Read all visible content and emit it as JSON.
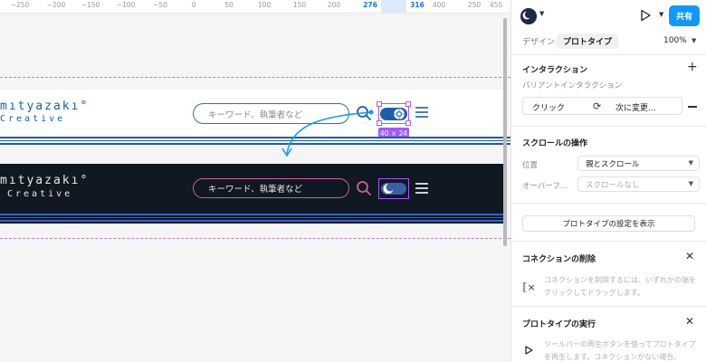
{
  "ruler": {
    "ticks": [
      "−250",
      "−200",
      "−150",
      "−100",
      "−50",
      "0",
      "50",
      "100",
      "150",
      "200",
      "250",
      "276",
      "316",
      "400",
      "450"
    ]
  },
  "canvas": {
    "logo_line1": "mıtyazakı°",
    "logo_line2": "Creative",
    "search_placeholder_light": "キーワード、執筆者など",
    "search_placeholder_dark": "キーワード、執筆者など",
    "size_badge": "40 × 24"
  },
  "toolbar": {
    "share_label": "共有",
    "tabs": [
      "デザイン",
      "プロトタイプ"
    ],
    "active_tab": "プロトタイプ",
    "zoom": "100%"
  },
  "interaction": {
    "title": "インタラクション",
    "subtitle": "バリアントインタラクション",
    "trigger": "クリック",
    "action": "次に変更..."
  },
  "scroll": {
    "title": "スクロールの操作",
    "position_label": "位置",
    "position_value": "親とスクロール",
    "overflow_label": "オーバーフ...",
    "overflow_value": "スクロールなし"
  },
  "settings_button": "プロトタイプの設定を表示",
  "connection": {
    "title": "コネクションの削除",
    "help": "コネクションを削除するには、いずれかの端をクリックしてドラッグします。"
  },
  "run": {
    "title": "プロトタイプの実行",
    "help": "ツールバーの再生ボタンを使ってプロトタイプを再生します。コネクションがない場合、"
  },
  "colors": {
    "accent": "#0d99ff",
    "selection": "#a259ff",
    "brand_blue": "#1a5fa8",
    "dark_header": "#101822",
    "pink": "#d05fa0"
  }
}
